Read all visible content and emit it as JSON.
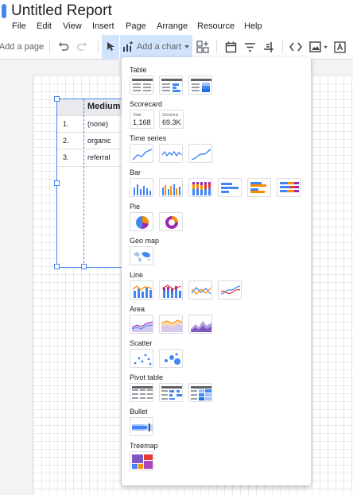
{
  "report": {
    "title": "Untitled Report"
  },
  "menu": [
    "File",
    "Edit",
    "View",
    "Insert",
    "Page",
    "Arrange",
    "Resource",
    "Help"
  ],
  "toolbar": {
    "add_page": "Add a page",
    "add_chart": "Add a chart"
  },
  "table_widget": {
    "header": "Medium",
    "rows": [
      {
        "num": "1.",
        "value": "(none)"
      },
      {
        "num": "2.",
        "value": "organic"
      },
      {
        "num": "3.",
        "value": "referral"
      }
    ]
  },
  "chart_menu": {
    "sections": [
      "Table",
      "Scorecard",
      "Time series",
      "Bar",
      "Pie",
      "Geo map",
      "Line",
      "Area",
      "Scatter",
      "Pivot table",
      "Bullet",
      "Treemap"
    ],
    "scorecards": [
      {
        "label": "Total",
        "value": "1,168"
      },
      {
        "label": "Sessions",
        "value": "69.3K"
      }
    ]
  },
  "colors": {
    "accent": "#4285f4",
    "orange": "#fb8c00",
    "purple": "#9c27b0",
    "red": "#e53935"
  }
}
